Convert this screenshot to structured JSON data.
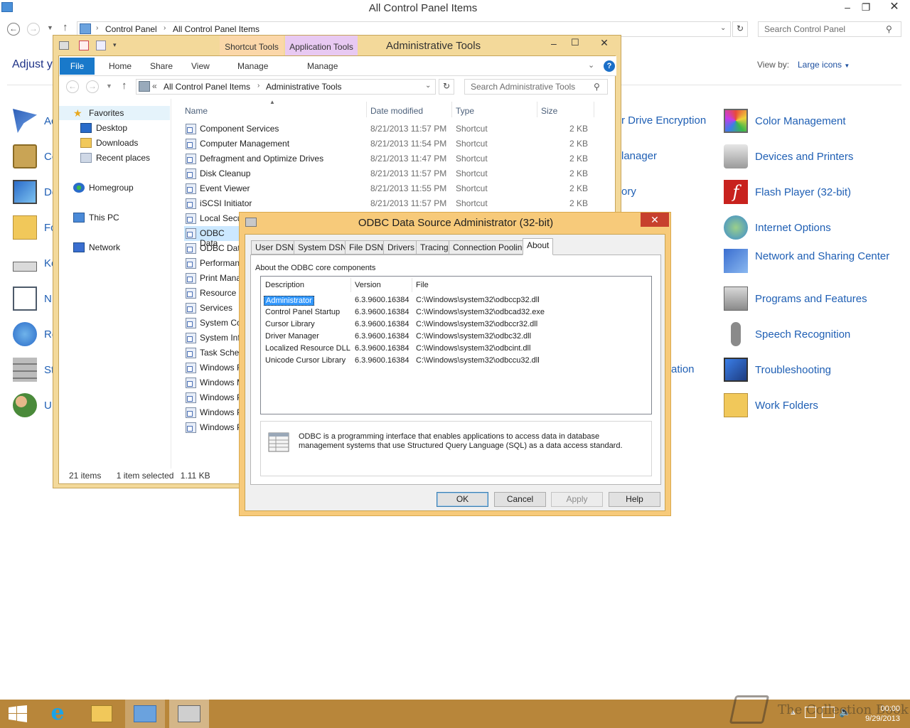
{
  "control_panel": {
    "title": "All Control Panel Items",
    "breadcrumb": [
      "Control Panel",
      "All Control Panel Items"
    ],
    "search_placeholder": "Search Control Panel",
    "adjust_text": "Adjust your computer's settings",
    "view_by_label": "View by:",
    "view_by_value": "Large icons",
    "left_items": [
      "Ac",
      "Co",
      "De",
      "Fo",
      "Ke",
      "N",
      "Re",
      "St",
      "U"
    ],
    "middle_fragments": [
      "r Drive Encryption",
      "lanager",
      "ory",
      "ation"
    ],
    "right_items": [
      "Color Management",
      "Devices and Printers",
      "Flash Player (32-bit)",
      "Internet Options",
      "Network and Sharing Center",
      "Programs and Features",
      "Speech Recognition",
      "Troubleshooting",
      "Work Folders"
    ]
  },
  "admin_tools": {
    "title": "Administrative Tools",
    "context_tabs": [
      "Shortcut Tools",
      "Application Tools"
    ],
    "ribbon_tabs": [
      "File",
      "Home",
      "Share",
      "View",
      "Manage",
      "Manage"
    ],
    "breadcrumb": [
      "All Control Panel Items",
      "Administrative Tools"
    ],
    "search_placeholder": "Search Administrative Tools",
    "tree": {
      "favorites": "Favorites",
      "desktop": "Desktop",
      "downloads": "Downloads",
      "recent": "Recent places",
      "homegroup": "Homegroup",
      "this_pc": "This PC",
      "network": "Network"
    },
    "columns": [
      "Name",
      "Date modified",
      "Type",
      "Size"
    ],
    "files": [
      {
        "name": "Component Services",
        "date": "8/21/2013 11:57 PM",
        "type": "Shortcut",
        "size": "2 KB"
      },
      {
        "name": "Computer Management",
        "date": "8/21/2013 11:54 PM",
        "type": "Shortcut",
        "size": "2 KB"
      },
      {
        "name": "Defragment and Optimize Drives",
        "date": "8/21/2013 11:47 PM",
        "type": "Shortcut",
        "size": "2 KB"
      },
      {
        "name": "Disk Cleanup",
        "date": "8/21/2013 11:57 PM",
        "type": "Shortcut",
        "size": "2 KB"
      },
      {
        "name": "Event Viewer",
        "date": "8/21/2013 11:55 PM",
        "type": "Shortcut",
        "size": "2 KB"
      },
      {
        "name": "iSCSI Initiator",
        "date": "8/21/2013 11:57 PM",
        "type": "Shortcut",
        "size": "2 KB"
      },
      {
        "name": "Local Secu",
        "date": "",
        "type": "",
        "size": ""
      },
      {
        "name": "ODBC Data",
        "date": "",
        "type": "",
        "size": ""
      },
      {
        "name": "ODBC Data",
        "date": "",
        "type": "",
        "size": ""
      },
      {
        "name": "Performan",
        "date": "",
        "type": "",
        "size": ""
      },
      {
        "name": "Print Mana",
        "date": "",
        "type": "",
        "size": ""
      },
      {
        "name": "Resource M",
        "date": "",
        "type": "",
        "size": ""
      },
      {
        "name": "Services",
        "date": "",
        "type": "",
        "size": ""
      },
      {
        "name": "System Co",
        "date": "",
        "type": "",
        "size": ""
      },
      {
        "name": "System Inf",
        "date": "",
        "type": "",
        "size": ""
      },
      {
        "name": "Task Sched",
        "date": "",
        "type": "",
        "size": ""
      },
      {
        "name": "Windows F",
        "date": "",
        "type": "",
        "size": ""
      },
      {
        "name": "Windows M",
        "date": "",
        "type": "",
        "size": ""
      },
      {
        "name": "Windows P",
        "date": "",
        "type": "",
        "size": ""
      },
      {
        "name": "Windows P",
        "date": "",
        "type": "",
        "size": ""
      },
      {
        "name": "Windows P",
        "date": "",
        "type": "",
        "size": ""
      }
    ],
    "status_items": "21 items",
    "status_selected": "1 item selected",
    "status_size": "1.11 KB"
  },
  "odbc": {
    "title": "ODBC Data Source Administrator (32-bit)",
    "tabs": [
      "User DSN",
      "System DSN",
      "File DSN",
      "Drivers",
      "Tracing",
      "Connection Pooling",
      "About"
    ],
    "about_label": "About the ODBC core components",
    "list_columns": [
      "Description",
      "Version",
      "File"
    ],
    "components": [
      {
        "description": "Administrator",
        "version": "6.3.9600.16384",
        "file": "C:\\Windows\\system32\\odbccp32.dll"
      },
      {
        "description": "Control Panel Startup",
        "version": "6.3.9600.16384",
        "file": "C:\\Windows\\system32\\odbcad32.exe"
      },
      {
        "description": "Cursor Library",
        "version": "6.3.9600.16384",
        "file": "C:\\Windows\\system32\\odbccr32.dll"
      },
      {
        "description": "Driver Manager",
        "version": "6.3.9600.16384",
        "file": "C:\\Windows\\system32\\odbc32.dll"
      },
      {
        "description": "Localized Resource DLL",
        "version": "6.3.9600.16384",
        "file": "C:\\Windows\\system32\\odbcint.dll"
      },
      {
        "description": "Unicode Cursor Library",
        "version": "6.3.9600.16384",
        "file": "C:\\Windows\\system32\\odbccu32.dll"
      }
    ],
    "info_text": "ODBC is a programming interface that enables applications to access data in database management systems that use Structured Query Language (SQL) as a data access standard.",
    "buttons": {
      "ok": "OK",
      "cancel": "Cancel",
      "apply": "Apply",
      "help": "Help"
    }
  },
  "taskbar": {
    "watermark": "The Collection Book",
    "time": "00:00",
    "date": "9/29/2013"
  }
}
